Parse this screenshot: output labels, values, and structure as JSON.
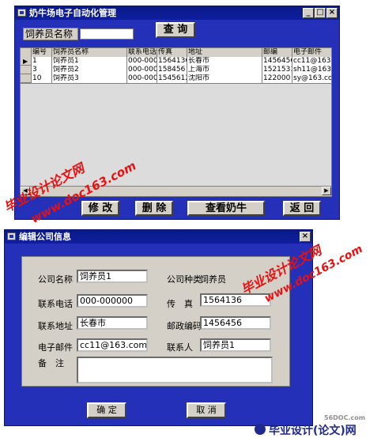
{
  "main_window": {
    "title": "奶牛场电子自动化管理",
    "search_label": "饲养员名称",
    "search_value": "",
    "query_button": "查 询",
    "table": {
      "columns": [
        "编号",
        "饲养员名称",
        "联系电话",
        "传真",
        "地址",
        "邮编",
        "电子邮件"
      ],
      "rows": [
        [
          "1",
          "饲养员1",
          "000-0000(",
          "1564136",
          "长春市",
          "1456456",
          "cc11@163.cc"
        ],
        [
          "3",
          "饲养员2",
          "000-0000(",
          "158456",
          "上海市",
          "1521533",
          "sh11@163.cc"
        ],
        [
          "10",
          "饲养员3",
          "000-0000(",
          "15456123",
          "沈阳市",
          "122000",
          "sy@163.com"
        ]
      ]
    },
    "buttons": {
      "edit": "修 改",
      "delete": "删 除",
      "view_cows": "查看奶牛",
      "back": "返 回"
    }
  },
  "edit_dialog": {
    "title": "编辑公司信息",
    "fields": {
      "company_name_label": "公司名称",
      "company_name": "饲养员1",
      "company_type_label": "公司种类",
      "company_type": "饲养员",
      "phone_label": "联系电话",
      "phone": "000-000000",
      "fax_label": "传　真",
      "fax": "1564136",
      "address_label": "联系地址",
      "address": "长春市",
      "postcode_label": "邮政编码",
      "postcode": "1456456",
      "email_label": "电子邮件",
      "email": "cc11@163.com",
      "contact_label": "联系人",
      "contact": "饲养员1",
      "notes_label": "备　注",
      "notes": ""
    },
    "buttons": {
      "ok": "确 定",
      "cancel": "取 消"
    }
  },
  "watermarks": {
    "mark1": "毕业设计论文网",
    "mark2": "www.doc163.com",
    "mark3": "毕业设计论文网",
    "mark4": "www.doc163.com",
    "footer_site": "56DOC.com",
    "footer_brand": "毕业设计(论文)网"
  }
}
